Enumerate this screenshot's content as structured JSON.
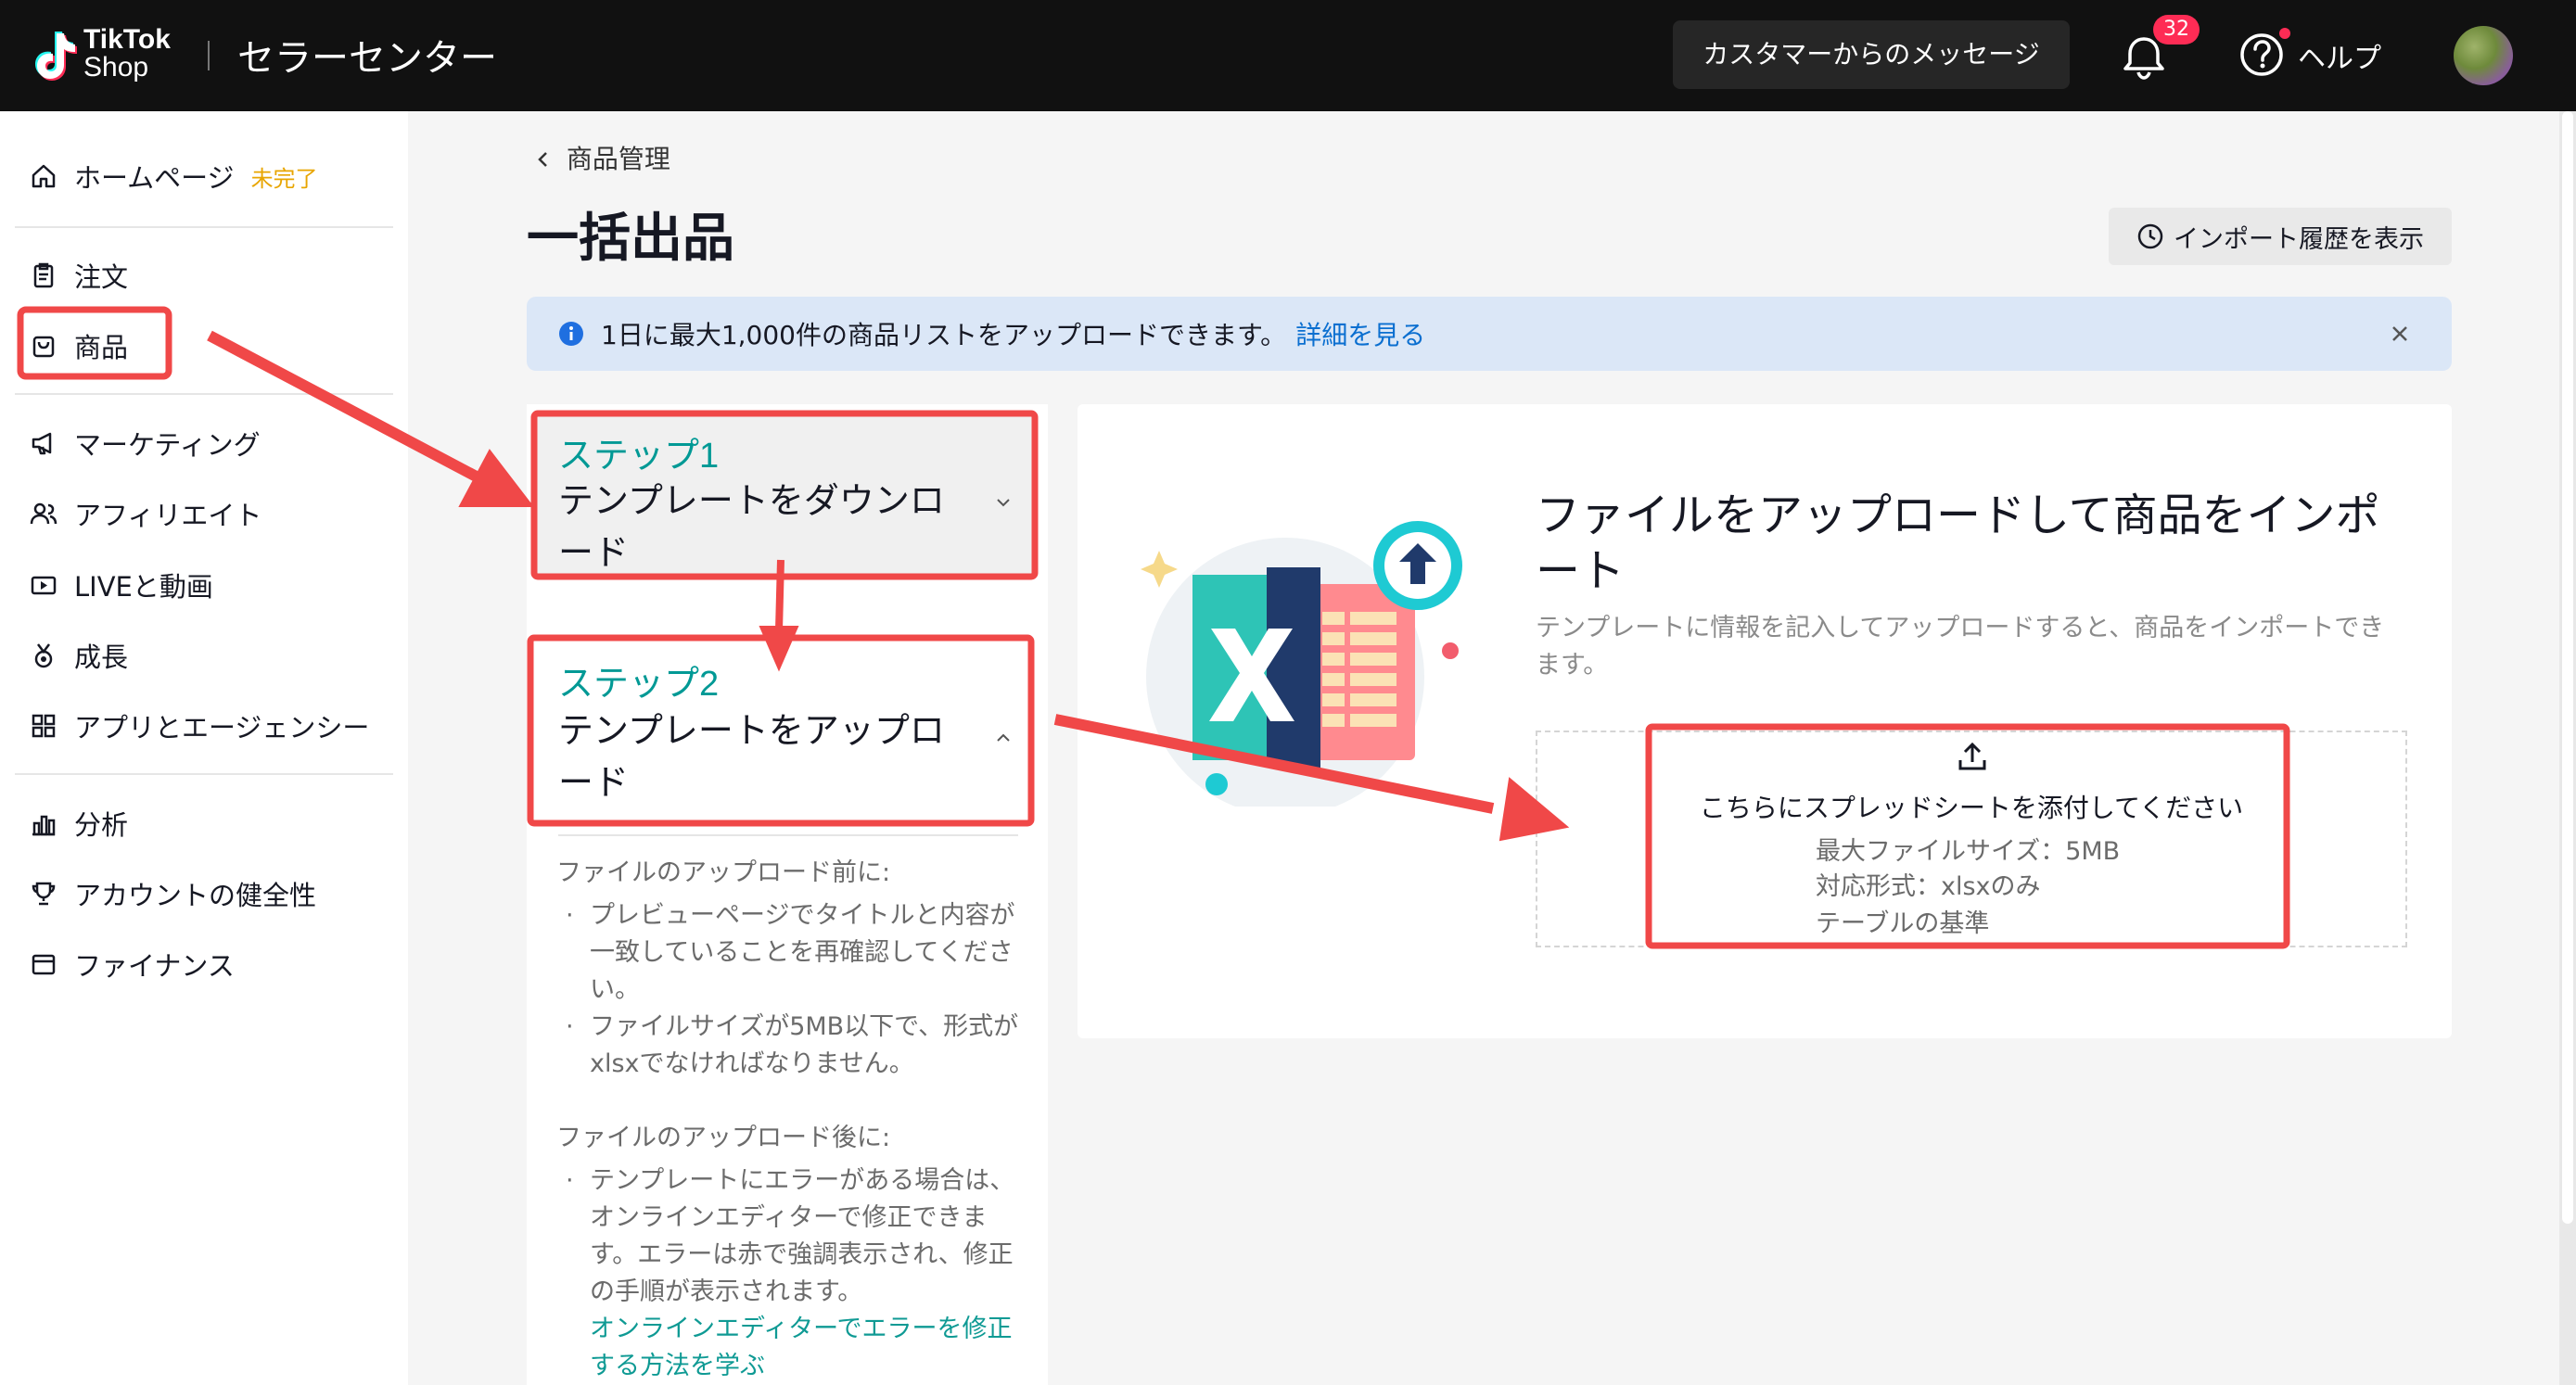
{
  "topbar": {
    "logo_line1": "TikTok",
    "logo_line2": "Shop",
    "title": "セラーセンター",
    "message_button": "カスタマーからのメッセージ",
    "notification_count": "32",
    "help_label": "ヘルプ"
  },
  "sidebar": {
    "items": [
      {
        "label": "ホームページ",
        "tag": "未完了",
        "icon": "home-icon"
      },
      {
        "label": "注文",
        "icon": "clipboard-icon"
      },
      {
        "label": "商品",
        "icon": "product-bag-icon"
      },
      {
        "label": "マーケティング",
        "icon": "megaphone-icon"
      },
      {
        "label": "アフィリエイト",
        "icon": "people-icon"
      },
      {
        "label": "LIVEと動画",
        "icon": "video-icon"
      },
      {
        "label": "成長",
        "icon": "medal-icon"
      },
      {
        "label": "アプリとエージェンシー",
        "icon": "apps-grid-icon"
      },
      {
        "label": "分析",
        "icon": "bar-chart-icon"
      },
      {
        "label": "アカウントの健全性",
        "icon": "trophy-icon"
      },
      {
        "label": "ファイナンス",
        "icon": "wallet-icon"
      }
    ]
  },
  "main": {
    "breadcrumb": "商品管理",
    "page_title": "一括出品",
    "history_button": "インポート履歴を表示",
    "banner": {
      "text": "1日に最大1,000件の商品リストをアップロードできます。",
      "link": "詳細を見る"
    },
    "step1": {
      "label": "ステップ1",
      "title": "テンプレートをダウンロード"
    },
    "step2": {
      "label": "ステップ2",
      "title": "テンプレートをアップロード"
    },
    "notes": {
      "before_heading": "ファイルのアップロード前に:",
      "before_items": [
        "プレビューページでタイトルと内容が一致していることを再確認してください。",
        "ファイルサイズが5MB以下で、形式がxlsxでなければなりません。"
      ],
      "after_heading": "ファイルのアップロード後に:",
      "after_item": "テンプレートにエラーがある場合は、オンラインエディターで修正できます。エラーは赤で強調表示され、修正の手順が表示されます。",
      "after_link": "オンラインエディターでエラーを修正する方法を学ぶ"
    },
    "upload": {
      "title": "ファイルをアップロードして商品をインポート",
      "description": "テンプレートに情報を記入してアップロードすると、商品をインポートできます。",
      "drop_label": "こちらにスプレッドシートを添付してください",
      "max_size": "最大ファイルサイズ：5MB",
      "format": "対応形式：xlsxのみ",
      "table_standard": "テーブルの基準"
    }
  },
  "colors": {
    "accent_teal": "#009995",
    "link_blue": "#0b6fd0",
    "annotation_red": "#f04848",
    "badge_red": "#fe2c55"
  }
}
